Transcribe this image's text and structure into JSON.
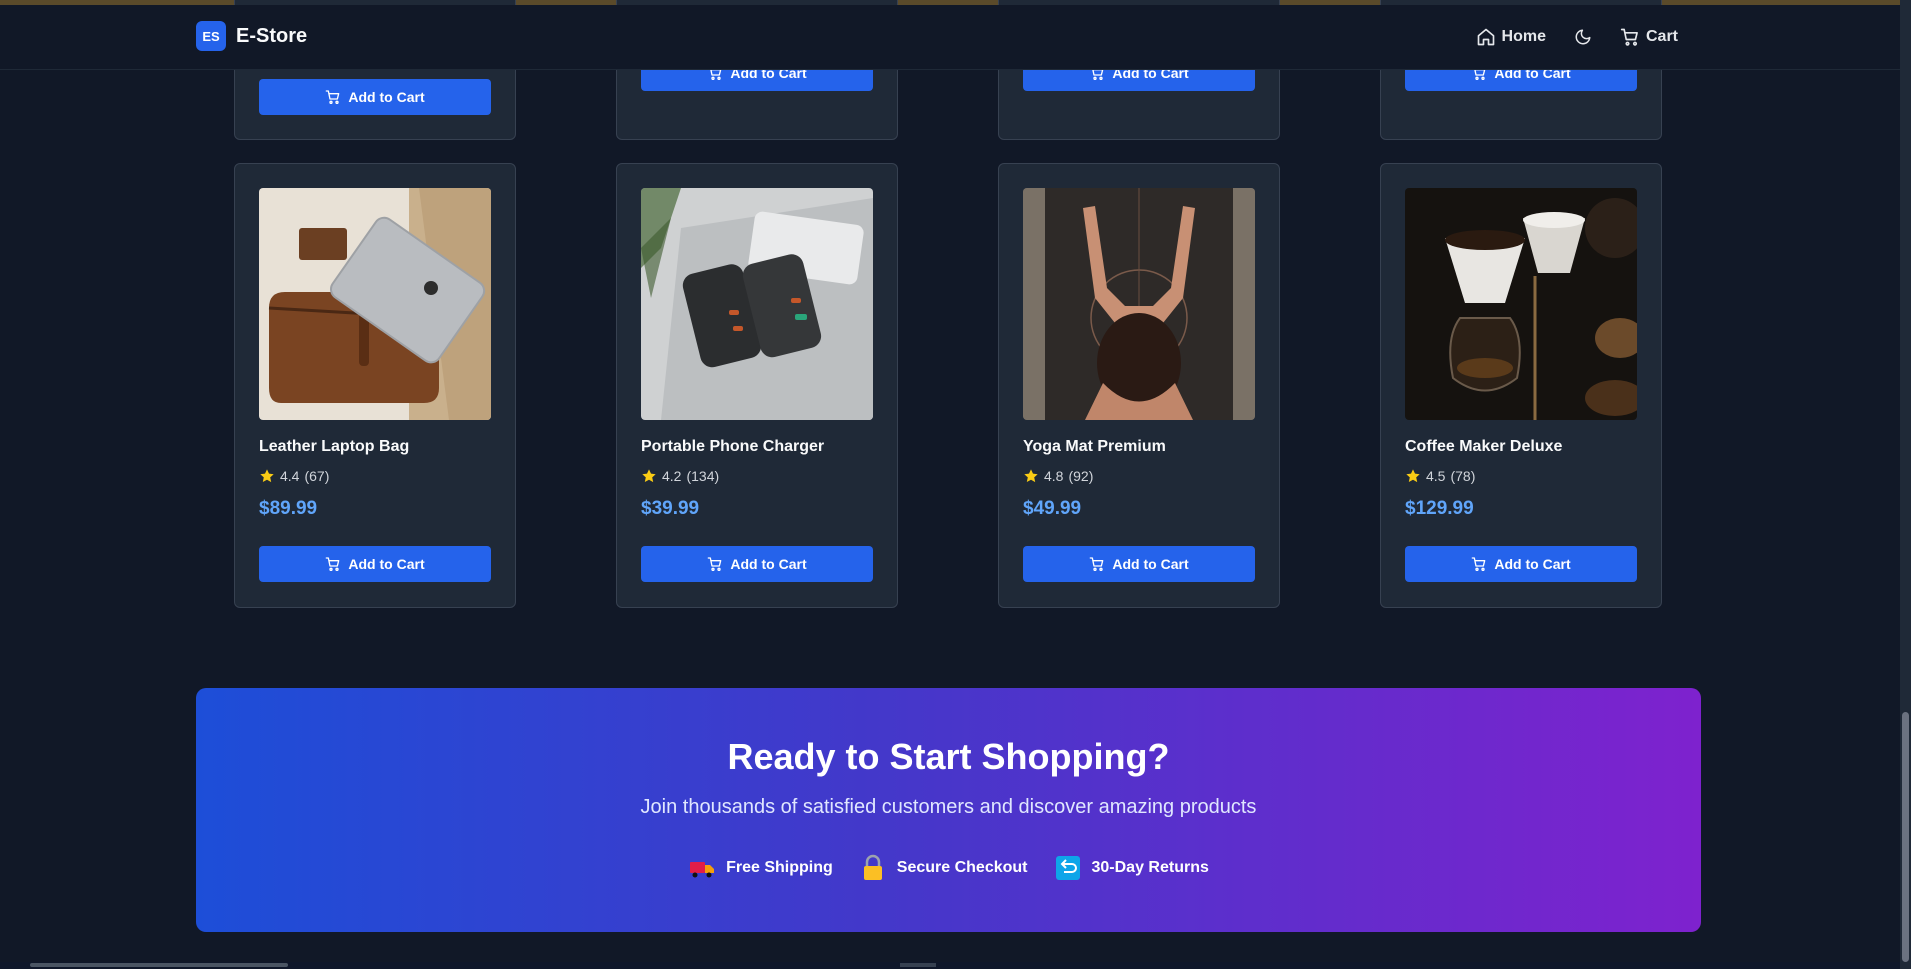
{
  "navbar": {
    "logo_text": "ES",
    "brand": "E-Store",
    "home_label": "Home",
    "cart_label": "Cart"
  },
  "top_row": {
    "add_to_cart": "Add to Cart"
  },
  "products": [
    {
      "name": "Leather Laptop Bag",
      "rating": "4.4",
      "reviews": "(67)",
      "price": "$89.99",
      "button": "Add to Cart"
    },
    {
      "name": "Portable Phone Charger",
      "rating": "4.2",
      "reviews": "(134)",
      "price": "$39.99",
      "button": "Add to Cart"
    },
    {
      "name": "Yoga Mat Premium",
      "rating": "4.8",
      "reviews": "(92)",
      "price": "$49.99",
      "button": "Add to Cart"
    },
    {
      "name": "Coffee Maker Deluxe",
      "rating": "4.5",
      "reviews": "(78)",
      "price": "$129.99",
      "button": "Add to Cart"
    }
  ],
  "cta": {
    "title": "Ready to Start Shopping?",
    "subtitle": "Join thousands of satisfied customers and discover amazing products",
    "features": [
      "Free Shipping",
      "Secure Checkout",
      "30-Day Returns"
    ]
  },
  "colors": {
    "background": "#111827",
    "card": "#1f2937",
    "accent": "#2563eb",
    "price": "#60a5fa",
    "star": "#facc15"
  },
  "icons": [
    "home-icon",
    "moon-icon",
    "cart-icon",
    "star-icon",
    "truck-icon",
    "lock-icon",
    "return-icon"
  ]
}
